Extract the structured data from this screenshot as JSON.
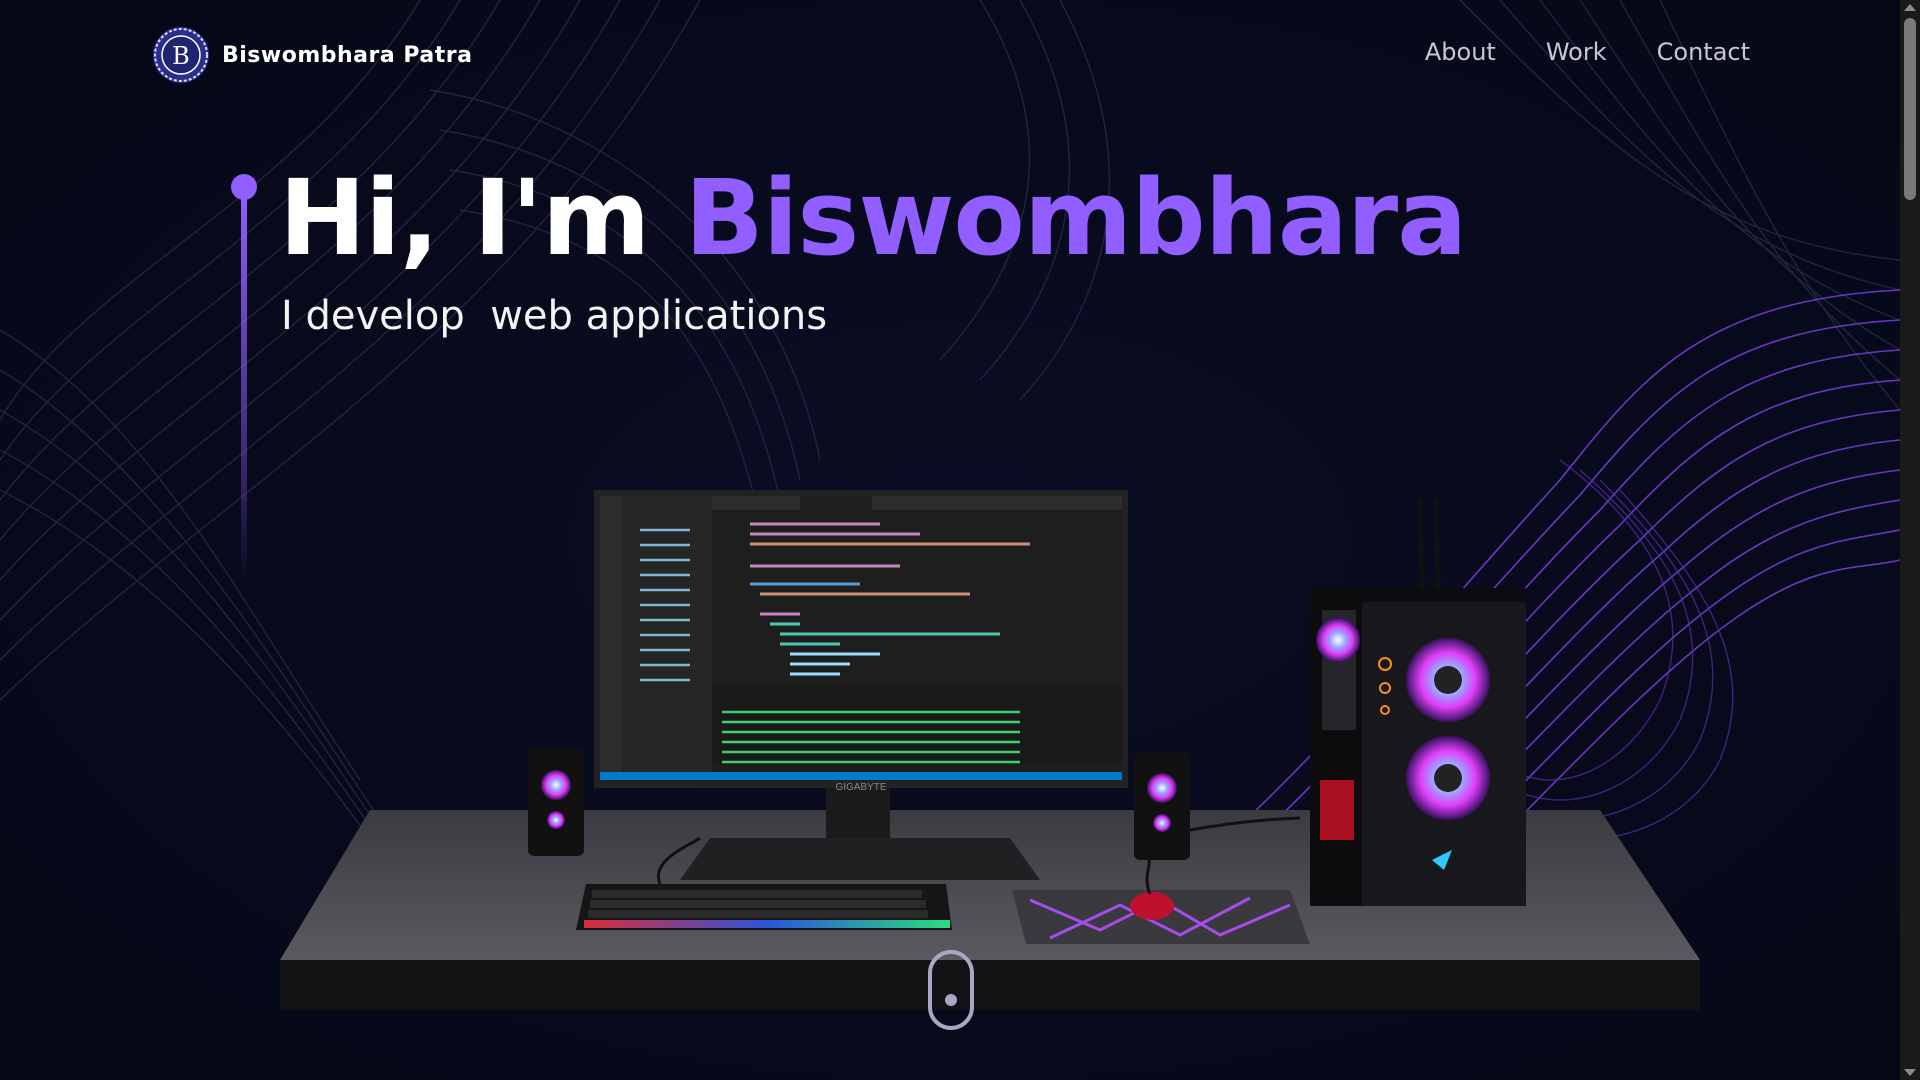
{
  "brand": {
    "logo_letter": "B",
    "name": "Biswombhara Patra"
  },
  "nav": {
    "links": [
      {
        "label": "About"
      },
      {
        "label": "Work"
      },
      {
        "label": "Contact"
      }
    ]
  },
  "hero": {
    "greeting": "Hi, I'm ",
    "name": "Biswombhara",
    "subtitle": "I develop  web applications"
  },
  "scene": {
    "monitor_brand": "GIGABYTE"
  },
  "colors": {
    "background": "#050816",
    "accent": "#915eff",
    "nav_text": "#c8c8d4",
    "scroll_indicator": "#aaa6c3"
  },
  "icons": [
    "logo-seal-icon",
    "mouse-scroll-icon",
    "scroll-up-arrow-icon",
    "scroll-down-arrow-icon"
  ]
}
